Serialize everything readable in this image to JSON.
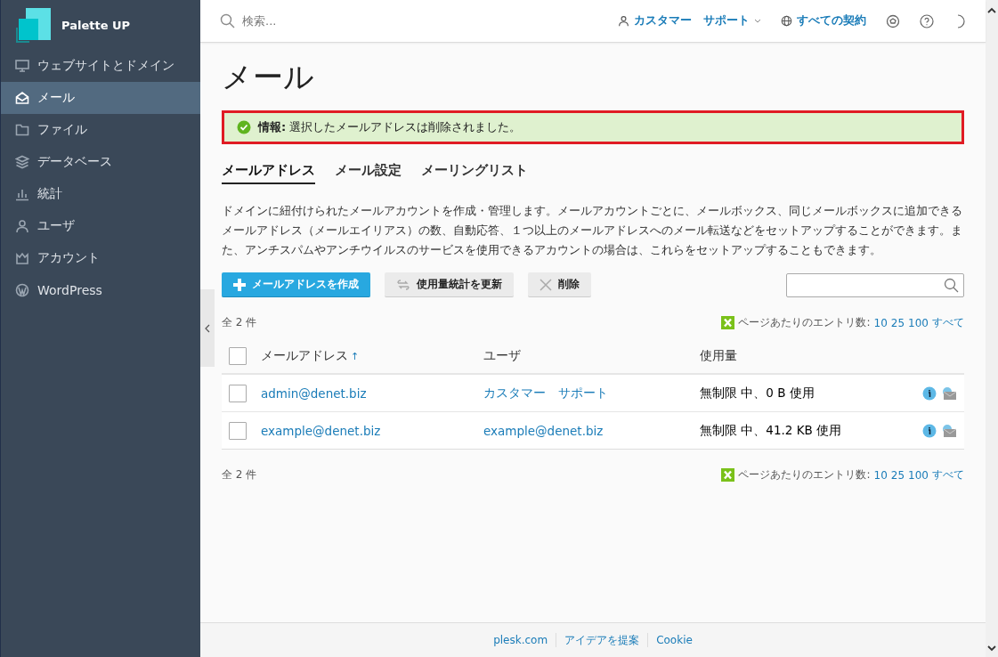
{
  "brand": {
    "name": "Palette UP"
  },
  "sidebar": {
    "items": [
      {
        "label": "ウェブサイトとドメイン",
        "selected": false
      },
      {
        "label": "メール",
        "selected": true
      },
      {
        "label": "ファイル",
        "selected": false
      },
      {
        "label": "データベース",
        "selected": false
      },
      {
        "label": "統計",
        "selected": false
      },
      {
        "label": "ユーザ",
        "selected": false
      },
      {
        "label": "アカウント",
        "selected": false
      },
      {
        "label": "WordPress",
        "selected": false
      }
    ]
  },
  "topbar": {
    "search": {
      "placeholder": "検索..."
    },
    "user": "カスタマー　サポート",
    "subscriptions": "すべての契約"
  },
  "page": {
    "title": "メール",
    "message": {
      "label": "情報:",
      "text": "選択したメールアドレスは削除されました。",
      "highlighted": true
    },
    "tabs": [
      {
        "label": "メールアドレス",
        "selected": true
      },
      {
        "label": "メール設定",
        "selected": false
      },
      {
        "label": "メーリングリスト",
        "selected": false
      }
    ],
    "description": "ドメインに紐付けられたメールアカウントを作成・管理します。メールアカウントごとに、メールボックス、同じメールボックスに追加できるメールアドレス（メールエイリアス）の数、自動応答、１つ以上のメールアドレスへのメール転送などをセットアップすることができます。また、アンチスパムやアンチウイルスのサービスを使用できるアカウントの場合は、これらをセットアップすることもできます。",
    "buttons": [
      {
        "label": "メールアドレスを作成",
        "kind": "primary"
      },
      {
        "label": "使用量統計を更新",
        "kind": "refresh"
      },
      {
        "label": "削除",
        "kind": "delete"
      }
    ],
    "total_top": "全 2 件",
    "per_page_top": {
      "label": "ページあたりのエントリ数:",
      "options": [
        "10",
        "25",
        "100",
        "すべて"
      ]
    },
    "table": {
      "select_all": false,
      "columns": [
        "メールアドレス",
        "ユーザ",
        "使用量"
      ],
      "sort_mark": "↑",
      "rows": [
        {
          "checked": false,
          "email": "admin@denet.biz",
          "user": "カスタマー　サポート",
          "usage": "無制限 中、0 B 使用"
        },
        {
          "checked": false,
          "email": "example@denet.biz",
          "user": "example@denet.biz",
          "usage": "無制限 中、41.2 KB 使用"
        }
      ]
    },
    "total_bottom": "全 2 件",
    "per_page_bottom": {
      "label": "ページあたりのエントリ数:",
      "options": [
        "10",
        "25",
        "100",
        "すべて"
      ]
    }
  },
  "footer": {
    "links": [
      "plesk.com",
      "アイデアを提案",
      "Cookie"
    ]
  }
}
